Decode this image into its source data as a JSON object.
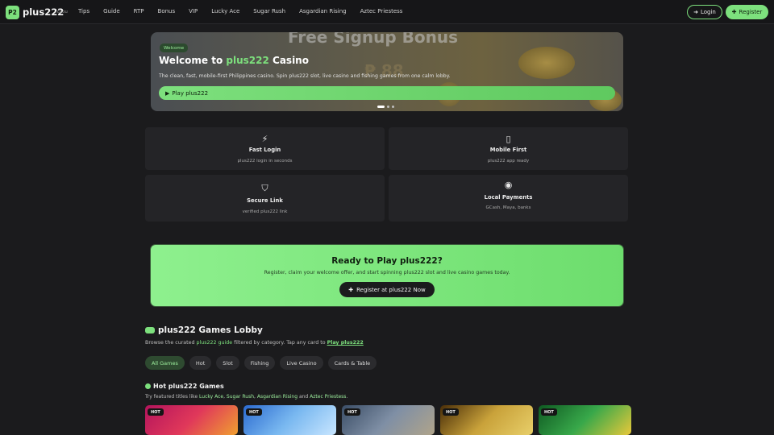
{
  "header": {
    "logo_badge": "P2",
    "logo_text": "plus222",
    "logo_sub": ".cyou",
    "nav": [
      "Tips",
      "Guide",
      "RTP",
      "Bonus",
      "VIP",
      "Lucky Ace",
      "Sugar Rush",
      "Asgardian Rising",
      "Aztec Priestess"
    ],
    "login_label": "Login",
    "register_label": "Register"
  },
  "hero": {
    "banner_text": "Free Signup Bonus",
    "banner_amount": "₱ 88",
    "pill": "Welcome",
    "title_prefix": "Welcome to ",
    "title_highlight": "plus222",
    "title_suffix": " Casino",
    "description": "The clean, fast, mobile-first Philippines casino. Spin plus222 slot, live casino and fishing games from one calm lobby.",
    "cta_label": "Play plus222",
    "slides": [
      true,
      false,
      false
    ]
  },
  "features": [
    {
      "icon": "bolt-icon",
      "glyph": "⚡",
      "title": "Fast Login",
      "subtitle": "plus222 login in seconds"
    },
    {
      "icon": "phone-icon",
      "glyph": "▯",
      "title": "Mobile First",
      "subtitle": "plus222 app ready"
    },
    {
      "icon": "shield-check-icon",
      "glyph": "⛉",
      "title": "Secure Link",
      "subtitle": "verified plus222 link"
    },
    {
      "icon": "coins-icon",
      "glyph": "◉",
      "title": "Local Payments",
      "subtitle": "GCash, Maya, banks"
    }
  ],
  "cta_panel": {
    "title": "Ready to Play plus222?",
    "description": "Register, claim your welcome offer, and start spinning plus222 slot and live casino games today.",
    "button_label": "Register at plus222 Now"
  },
  "lobby": {
    "title": "plus222 Games Lobby",
    "desc_prefix": "Browse the curated ",
    "desc_link1": "plus222 guide",
    "desc_middle": " filtered by category. Tap any card to ",
    "desc_link2": "Play plus222",
    "filters": [
      "All Games",
      "Hot",
      "Slot",
      "Fishing",
      "Live Casino",
      "Cards & Table"
    ],
    "active_filter": "All Games"
  },
  "hot": {
    "title": "Hot plus222 Games",
    "desc_prefix": "Try featured titles like ",
    "games_named": [
      "Lucky Ace",
      "Sugar Rush",
      "Asgardian Rising"
    ],
    "desc_and": " and ",
    "last_game": "Aztec Priestess",
    "desc_end": ".",
    "badge": "HOT",
    "cards": 5
  },
  "colors": {
    "accent": "#7de07d",
    "background": "#1b1b1d",
    "card": "#242427"
  }
}
